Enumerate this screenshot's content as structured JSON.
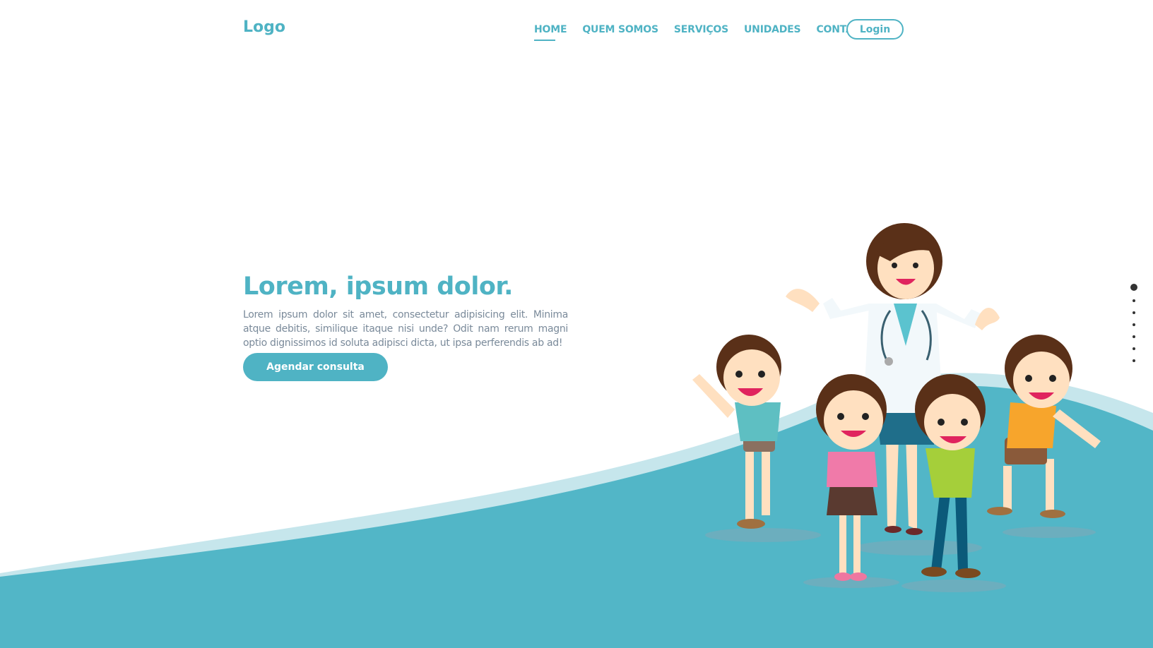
{
  "header": {
    "logo": "Logo",
    "nav": [
      {
        "label": "HOME",
        "active": true
      },
      {
        "label": "QUEM SOMOS",
        "active": false
      },
      {
        "label": "SERVIÇOS",
        "active": false
      },
      {
        "label": "UNIDADES",
        "active": false
      },
      {
        "label": "CONTATO",
        "active": false
      }
    ],
    "login_label": "Login"
  },
  "hero": {
    "title": "Lorem, ipsum dolor.",
    "text": "Lorem ipsum dolor sit amet, consectetur adipisicing elit. Minima atque debitis, similique itaque nisi unde? Odit nam rerum magni optio dignissimos id soluta adipisci dicta, ut ipsa perferendis ab ad!",
    "cta_label": "Agendar consulta"
  },
  "slider": {
    "count": 7,
    "active_index": 0
  },
  "colors": {
    "accent": "#4fb3c4",
    "wave": "#52b6c7",
    "wave_light": "#c6e6ec",
    "text_muted": "#7a8a9a"
  }
}
